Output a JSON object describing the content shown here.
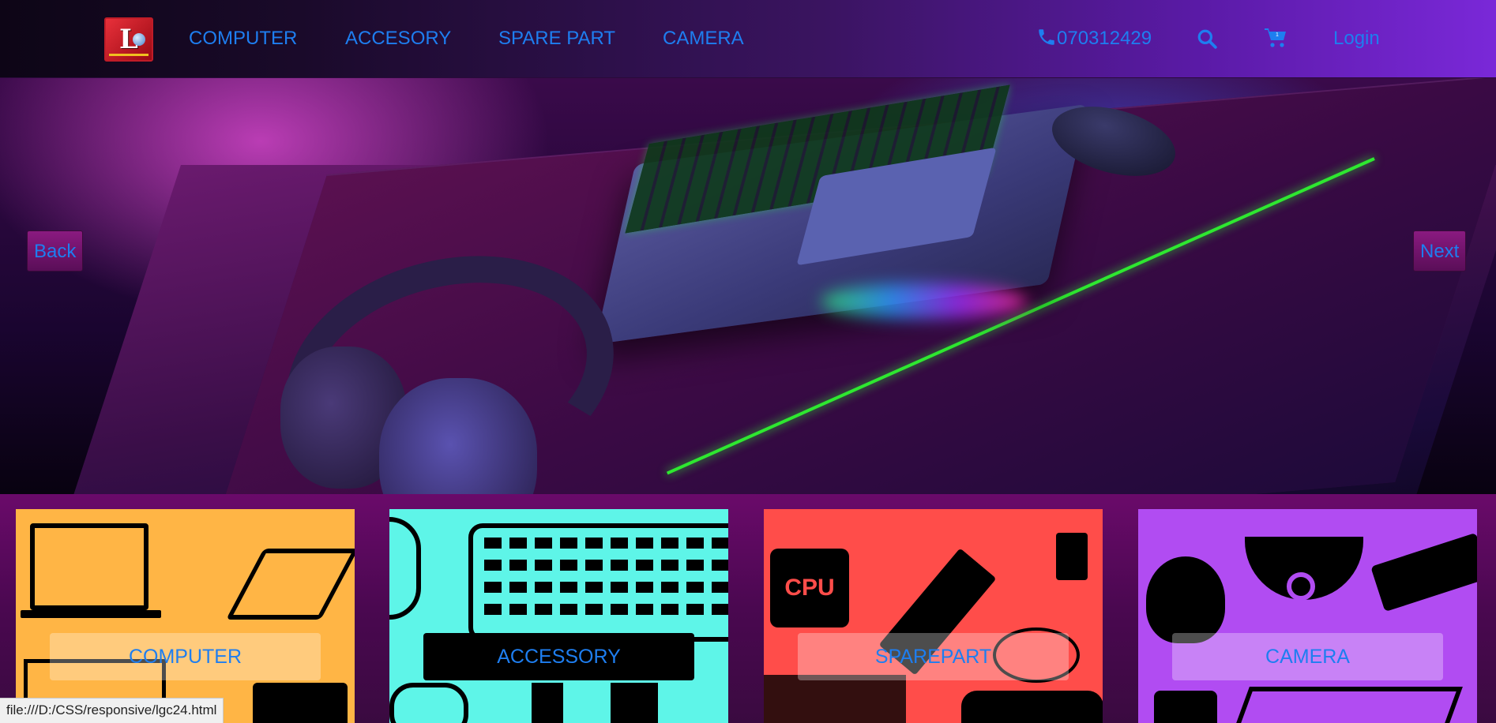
{
  "nav": {
    "logo_letter": "L",
    "links": [
      "COMPUTER",
      "ACCESORY",
      "SPARE PART",
      "CAMERA"
    ],
    "phone": "070312429",
    "cart_count": "1",
    "login": "Login"
  },
  "hero": {
    "back_label": "Back",
    "next_label": "Next"
  },
  "categories": [
    {
      "label": "COMPUTER",
      "color": "#ffb545"
    },
    {
      "label": "ACCESSORY",
      "color": "#5ef5e8"
    },
    {
      "label": "SPAREPART",
      "color": "#ff4d4a"
    },
    {
      "label": "CAMERA",
      "color": "#b14cf2"
    }
  ],
  "status": {
    "url": "file:///D:/CSS/responsive/lgc24.html"
  },
  "colors": {
    "link": "#1e7ef0",
    "accent_green": "#2ee830"
  }
}
